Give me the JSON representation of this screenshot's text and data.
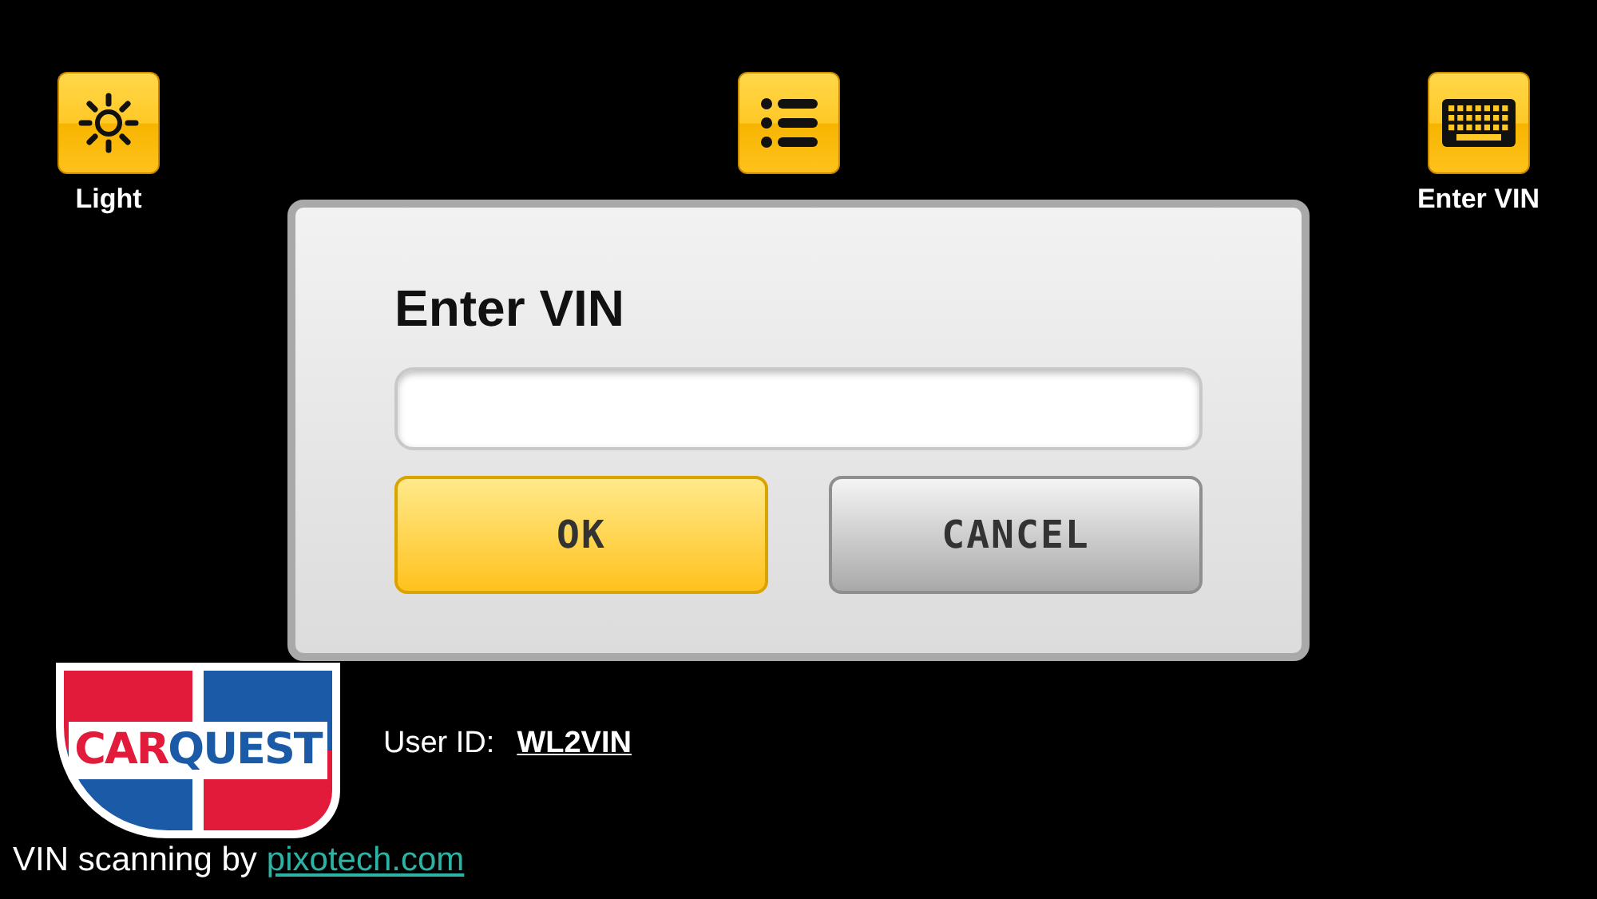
{
  "toolbar": [
    {
      "kind": "sun",
      "label": "Light"
    },
    {
      "kind": "list"
    },
    {
      "kind": "keyboard",
      "label": "Enter VIN"
    }
  ],
  "dialog": {
    "title": "Enter VIN",
    "buttons": [
      {
        "label": "OK",
        "kind": "primary"
      },
      {
        "label": "CANCEL",
        "kind": "secondary"
      }
    ]
  },
  "logo": {
    "parts": [
      {
        "text": "CAR",
        "color": "#e31b3b"
      },
      {
        "text": "QUEST",
        "color": "#1a5aa6"
      }
    ]
  },
  "user": {
    "label": "User ID:",
    "value": "WL2VIN"
  },
  "footer": {
    "text": "VIN scanning by",
    "link": "pixotech.com"
  }
}
